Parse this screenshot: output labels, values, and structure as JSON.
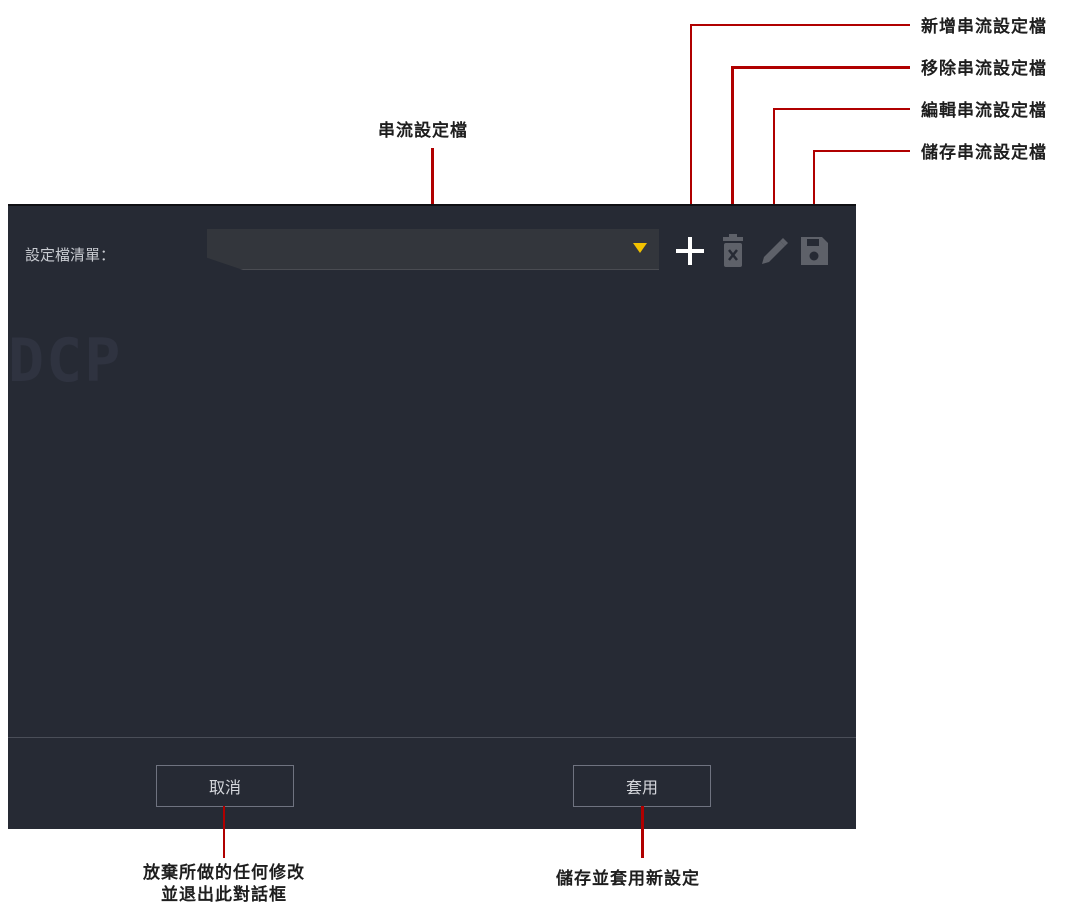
{
  "callouts": {
    "add_profile": "新增串流設定檔",
    "remove_profile": "移除串流設定檔",
    "edit_profile": "編輯串流設定檔",
    "save_profile": "儲存串流設定檔",
    "stream_profile": "串流設定檔",
    "cancel_desc_line1": "放棄所做的任何修改",
    "cancel_desc_line2": "並退出此對話框",
    "apply_desc": "儲存並套用新設定"
  },
  "dialog": {
    "profile_list_label": "設定檔清單：",
    "dropdown_value": "",
    "watermark": "DCP",
    "cancel_label": "取消",
    "apply_label": "套用"
  },
  "icons": [
    "plus-icon",
    "trash-icon",
    "pencil-icon",
    "floppy-disk-icon"
  ],
  "colors": {
    "panel_bg": "#262a34",
    "dropdown_bg": "#33363c",
    "dropdown_arrow": "#f2c200",
    "callout_line": "#b00000",
    "icon_active": "#ffffff",
    "icon_disabled": "#5e6169"
  }
}
